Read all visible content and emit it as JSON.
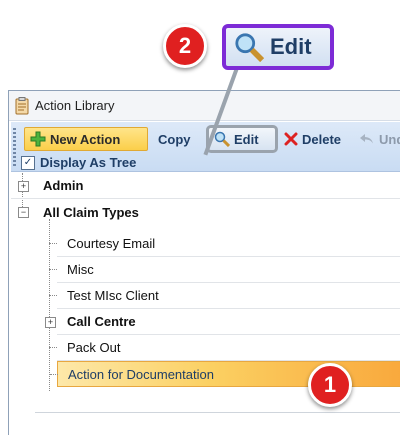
{
  "window": {
    "title": "Action Library"
  },
  "toolbar": {
    "new_action": "New Action",
    "copy": "Copy",
    "edit": "Edit",
    "delete": "Delete",
    "undo": "Und",
    "display_as_tree": "Display As Tree",
    "display_as_tree_checked": true
  },
  "tree": {
    "admin": "Admin",
    "all_claim_types": "All Claim Types",
    "children": [
      "Courtesy Email",
      "Misc",
      "Test MIsc Client",
      "Call Centre",
      "Pack Out",
      "Action for Documentation"
    ],
    "expander_plus": "+",
    "expander_minus": "−",
    "selected_item": "Action for Documentation"
  },
  "callouts": {
    "step1": "1",
    "step2": "2",
    "zoom_label": "Edit"
  },
  "colors": {
    "callout_red": "#e02020",
    "zoom_border": "#7d2bd6",
    "selection": "#fbd062",
    "toolbar": "#c9dcf3"
  },
  "icons": [
    "clipboard-icon",
    "plus-icon",
    "magnifier-icon",
    "delete-x-icon",
    "undo-icon"
  ]
}
